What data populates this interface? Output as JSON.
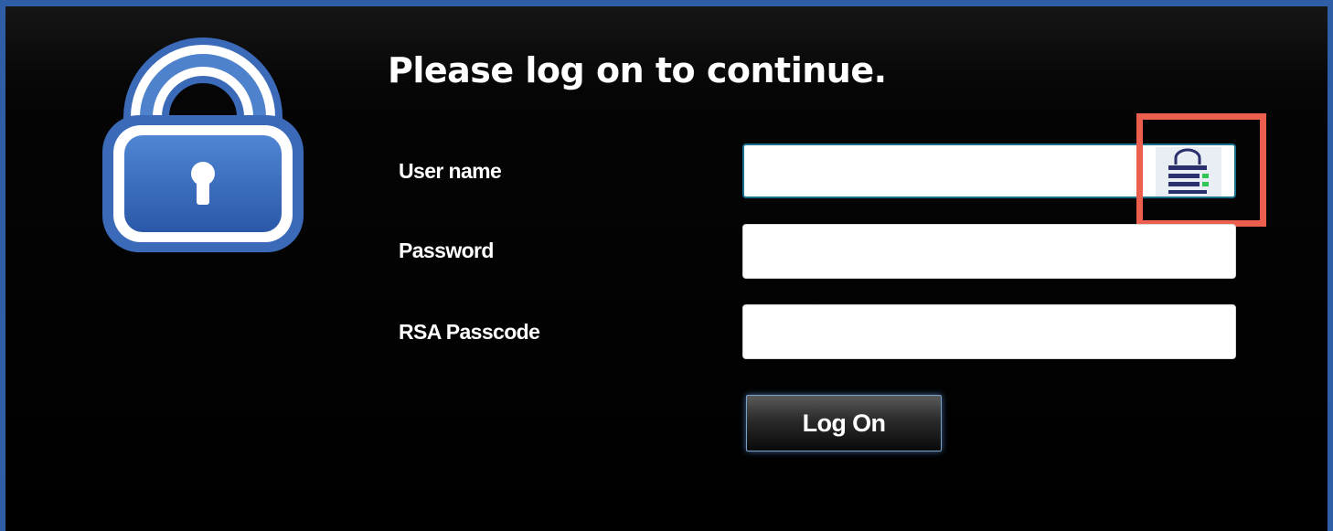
{
  "dialog": {
    "title": "Please log on to continue.",
    "logo_icon": "padlock-icon",
    "accent_color": "#2e5fa6",
    "background_color": "#000000"
  },
  "form": {
    "username": {
      "label": "User name",
      "value": ""
    },
    "password": {
      "label": "Password",
      "value": ""
    },
    "rsa_passcode": {
      "label": "RSA Passcode",
      "value": ""
    },
    "username_addon_icon": "password-manager-icon",
    "highlight_color": "#ec5f4e"
  },
  "actions": {
    "logon_label": "Log On"
  }
}
